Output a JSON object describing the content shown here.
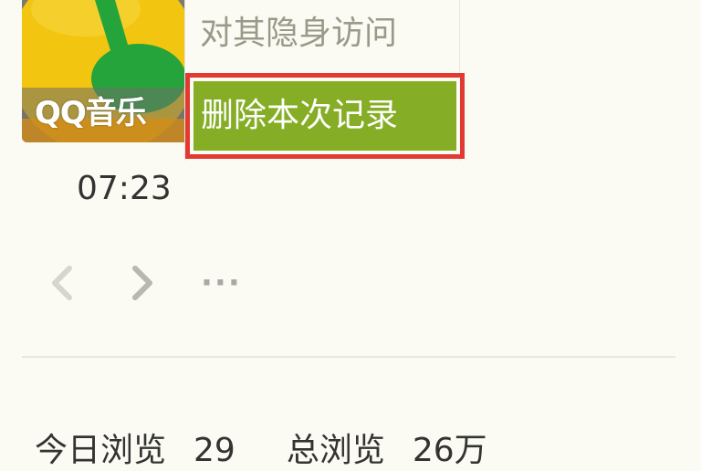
{
  "app": {
    "name": "QQ音乐",
    "icon": "qq-music-icon",
    "colors": {
      "yellow": "#f2c511",
      "green": "#24a43a"
    }
  },
  "menu": {
    "hide_visit_label": "对其隐身访问",
    "delete_record_label": "删除本次记录",
    "highlight_color": "#85ad25",
    "outline_color": "#e23a32"
  },
  "visit": {
    "time": "07:23"
  },
  "pager": {
    "prev_icon": "chevron-left-icon",
    "next_icon": "chevron-right-icon",
    "more_label": "···"
  },
  "stats": {
    "today_label": "今日浏览",
    "today_value": "29",
    "total_label": "总浏览",
    "total_value": "26万"
  }
}
